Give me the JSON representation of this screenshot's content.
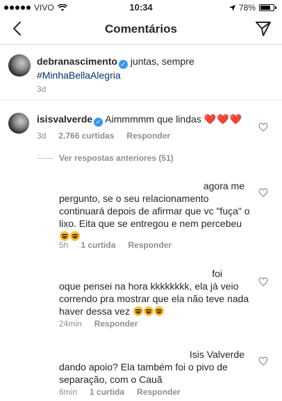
{
  "status": {
    "carrier": "VIVO",
    "time": "10:34",
    "battery": "78%"
  },
  "nav": {
    "title": "Comentários"
  },
  "caption": {
    "username": "debranascimento",
    "text": "juntas, sempre",
    "hashtag": "#MinhaBellaAlegria",
    "time": "3d"
  },
  "main_comment": {
    "username": "isisvalverde",
    "text": "Aimmmmm que lindas",
    "hearts": "❤️❤️❤️",
    "time": "3d",
    "likes": "2.766 curtidas",
    "reply_label": "Responder"
  },
  "view_replies": {
    "label": "Ver respostas anteriores (51)"
  },
  "replies": [
    {
      "text_line1": "agora me",
      "text_rest": "pergunto, se o seu relacionamento continuará depois de afirmar que vc \"fuça\" o lixo. Eita que se entregou e nem percebeu",
      "time": "5h",
      "likes": "1 curtida",
      "reply_label": "Responder"
    },
    {
      "text_line1": "foi",
      "text_rest": "oque pensei na hora kkkkkkkk, ela já veio correndo pra mostrar que ela não teve nada haver dessa vez",
      "time": "24min",
      "likes": "",
      "reply_label": "Responder"
    },
    {
      "text_line1": "Isis Valverde",
      "text_rest": "dando apoio? Ela também foi o pivo de separação, com o Cauã",
      "time": "6min",
      "likes": "1 curtida",
      "reply_label": "Responder"
    }
  ]
}
